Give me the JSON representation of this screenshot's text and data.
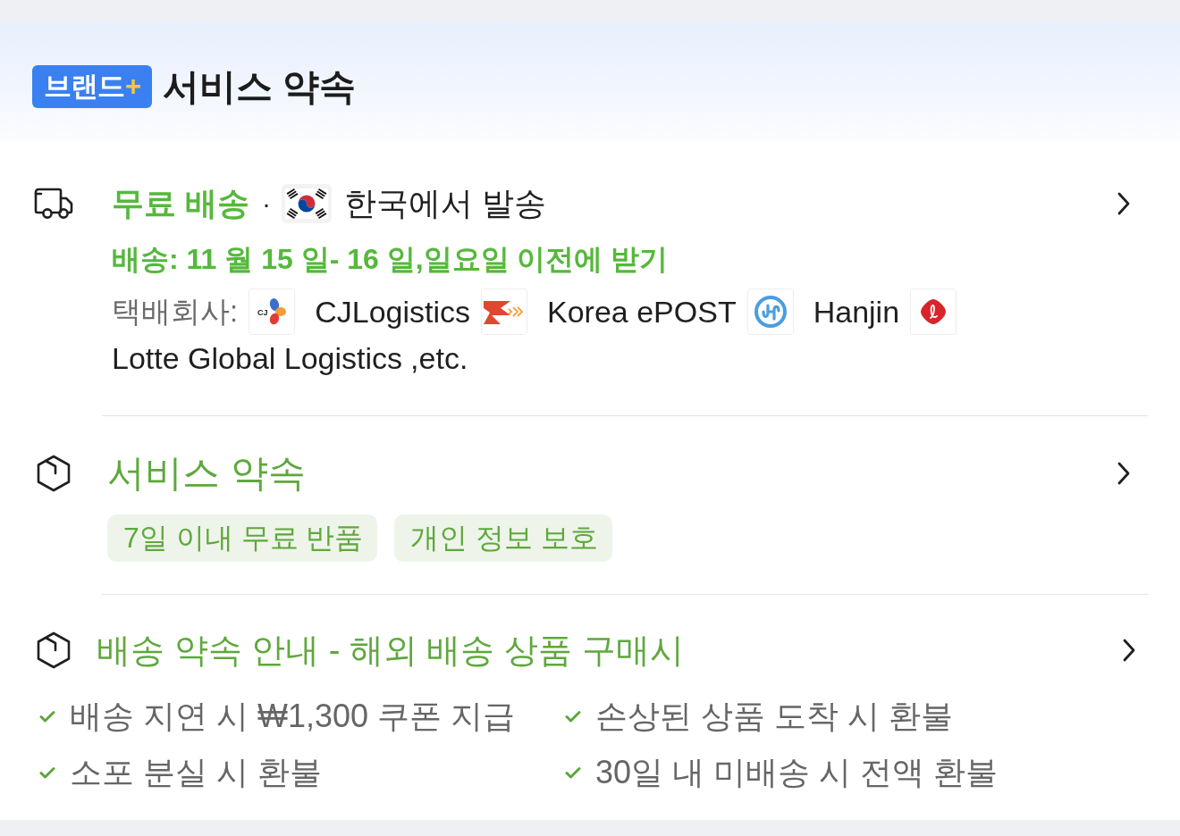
{
  "header": {
    "badge": {
      "label": "브랜드",
      "suffix": "+"
    },
    "title": "서비스 약속"
  },
  "sections": [
    {
      "kind": "shipping",
      "title": "무료 배송",
      "separator": "·",
      "origin": "한국에서 발송",
      "delivery": "배송: 11 월 15 일- 16 일,일요일 이전에 받기",
      "carriers_label": "택배회사:",
      "carriers": [
        {
          "kind": "petals",
          "logo_text": "CJ",
          "name": "CJLogistics"
        },
        {
          "kind": "wing",
          "name": "Korea ePOST"
        },
        {
          "kind": "ring",
          "name": "Hanjin"
        },
        {
          "kind": "script",
          "name": "Lotte Global Logistics"
        }
      ],
      "carriers_suffix": ",etc."
    },
    {
      "kind": "tags",
      "title": "서비스 약속",
      "tags": [
        "7일 이내 무료 반품",
        "개인 정보 보호"
      ]
    },
    {
      "kind": "checklist",
      "title": "배송 약속 안내 - 해외 배송 상품 구매시",
      "items": [
        "배송 지연 시 ₩1,300 쿠폰 지급",
        "손상된 상품 도착 시 환불",
        "소포 분실 시 환불",
        "30일 내 미배송 시 전액 환불"
      ]
    }
  ]
}
